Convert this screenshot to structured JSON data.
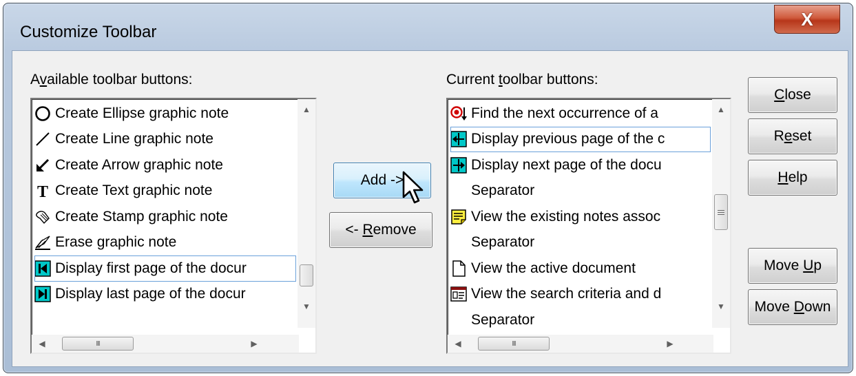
{
  "window": {
    "title": "Customize Toolbar",
    "close_glyph": "X"
  },
  "available": {
    "label_pre": "A",
    "label_key": "v",
    "label_post": "ailable toolbar buttons:",
    "items": [
      {
        "icon": "ellipse-icon",
        "text": "Create Ellipse graphic note"
      },
      {
        "icon": "line-icon",
        "text": "Create Line graphic note"
      },
      {
        "icon": "arrow-icon",
        "text": "Create Arrow graphic note"
      },
      {
        "icon": "text-icon",
        "text": "Create Text graphic note"
      },
      {
        "icon": "stamp-icon",
        "text": "Create Stamp graphic note"
      },
      {
        "icon": "eraser-icon",
        "text": "Erase graphic note"
      },
      {
        "icon": "first-page-icon",
        "text": "Display first page of the docur"
      },
      {
        "icon": "last-page-icon",
        "text": "Display last page of the docur"
      }
    ],
    "hscroll_grip": "III"
  },
  "current": {
    "label_pre": "Current ",
    "label_key": "t",
    "label_post": "oolbar buttons:",
    "items": [
      {
        "icon": "find-next-icon",
        "text": "Find the next occurrence of a"
      },
      {
        "icon": "previous-page-icon",
        "text": "Display previous page of the c"
      },
      {
        "icon": "next-page-icon",
        "text": "Display next page of the docu"
      },
      {
        "icon": "",
        "text": "Separator"
      },
      {
        "icon": "notes-icon",
        "text": "View the existing notes assoc"
      },
      {
        "icon": "",
        "text": "Separator"
      },
      {
        "icon": "document-icon",
        "text": "View the active document"
      },
      {
        "icon": "search-criteria-icon",
        "text": "View the search criteria and d"
      },
      {
        "icon": "",
        "text": "Separator"
      }
    ],
    "hscroll_grip": "III"
  },
  "buttons": {
    "add": "Add ->",
    "remove_pre": "<- ",
    "remove_key": "R",
    "remove_post": "emove",
    "close_key": "C",
    "close_post": "lose",
    "reset_pre": "R",
    "reset_key": "e",
    "reset_post": "set",
    "help_key": "H",
    "help_post": "elp",
    "moveup_pre": "Move ",
    "moveup_key": "U",
    "moveup_post": "p",
    "movedown_pre": "Move ",
    "movedown_key": "D",
    "movedown_post": "own"
  },
  "colors": {
    "accent": "#3c7fb1",
    "close_red": "#c7432a",
    "cyan_icon": "#00c4c4"
  }
}
